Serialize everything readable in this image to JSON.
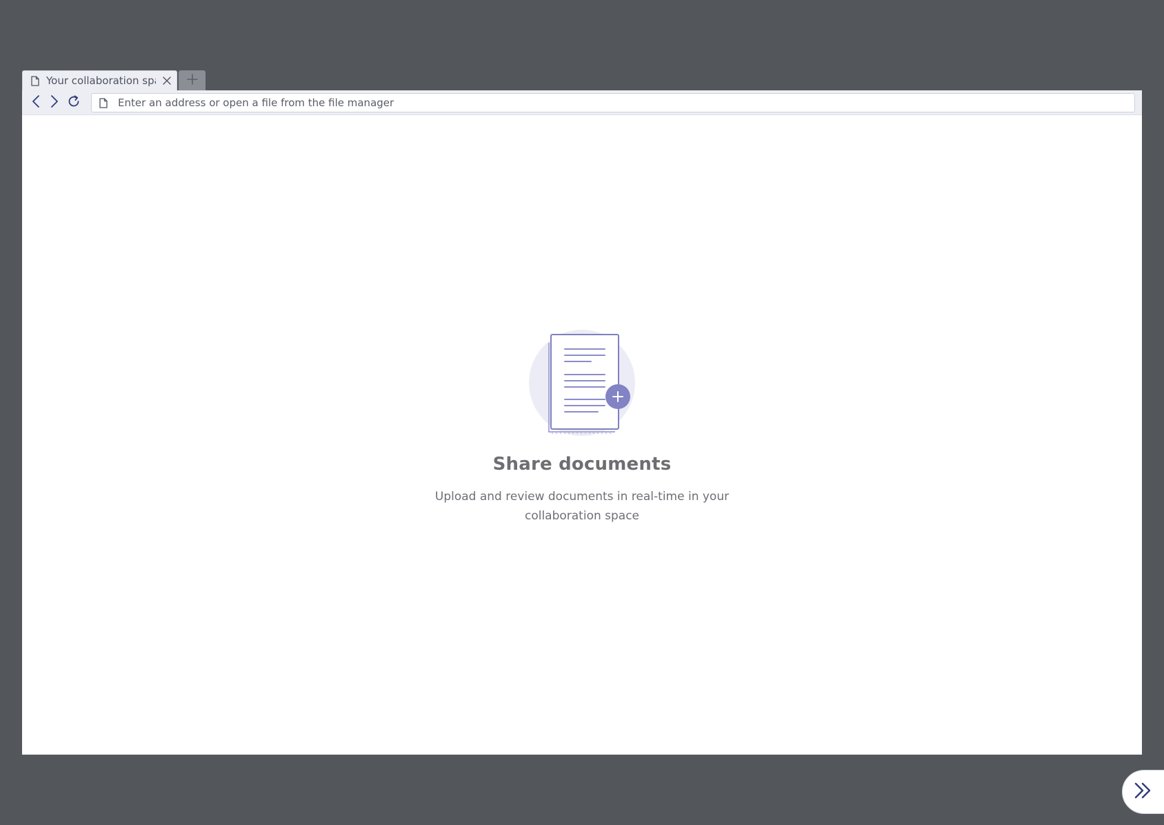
{
  "tab": {
    "title": "Your collaboration space",
    "icon": "document-icon",
    "close_icon": "close-icon"
  },
  "new_tab": {
    "icon": "plus-icon"
  },
  "toolbar": {
    "back_icon": "chevron-left-icon",
    "forward_icon": "chevron-right-icon",
    "reload_icon": "reload-icon",
    "address_placeholder": "Enter an address or open a file from the file manager",
    "address_value": ""
  },
  "empty_state": {
    "title": "Share documents",
    "description": "Upload and review documents in real-time in your collaboration space",
    "illustration": "document-add-illustration"
  },
  "expand_button": {
    "icon": "double-chevron-right-icon"
  },
  "colors": {
    "background": "#53575c",
    "chrome": "#eceef4",
    "accent": "#7f80bf",
    "nav_icon": "#323a7a",
    "illustration_circle": "#ececf6"
  }
}
